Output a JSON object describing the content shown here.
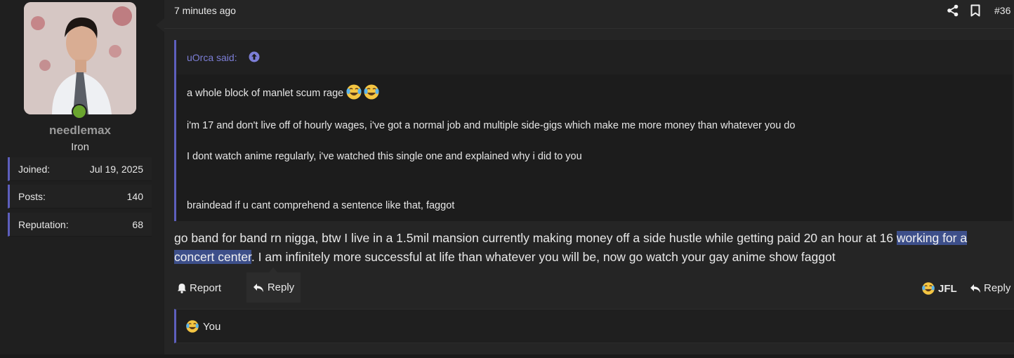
{
  "user": {
    "username": "needlemax",
    "rank": "Iron",
    "online": true,
    "stats": [
      {
        "label": "Joined:",
        "value": "Jul 19, 2025"
      },
      {
        "label": "Posts:",
        "value": "140"
      },
      {
        "label": "Reputation:",
        "value": "68"
      }
    ]
  },
  "post": {
    "time": "7 minutes ago",
    "number": "#36",
    "quote": {
      "author": "uOrca said:",
      "lines": [
        "a whole block of manlet scum rage",
        "i'm 17 and don't live off of hourly wages, i've got a normal job and multiple side-gigs which make me more money than whatever you do",
        "I dont watch anime regularly, i've watched this single one and explained why i did to you",
        "braindead if u cant comprehend a sentence like that, faggot"
      ]
    },
    "message": {
      "part1": "go band for band rn nigga, btw I live in a 1.5mil mansion currently making money off a side hustle while getting paid 20 an hour at 16 ",
      "highlighted": "working for a concert center",
      "part2": ". I am infinitely more successful at life than whatever you will be, now go watch your gay anime show faggot"
    },
    "actions": {
      "report": "Report",
      "reply": "Reply",
      "react": "JFL",
      "reply_right": "Reply"
    },
    "reactions_label": "You"
  },
  "colors": {
    "accent": "#5d5fbd",
    "link": "#7c7ed6",
    "online": "#6aa52f",
    "highlight": "#3d4f8a"
  },
  "icons": [
    "share-icon",
    "bookmark-icon",
    "arrow-up-circle-icon",
    "bell-icon",
    "reply-icon",
    "crying-laughing-emoji-icon"
  ]
}
